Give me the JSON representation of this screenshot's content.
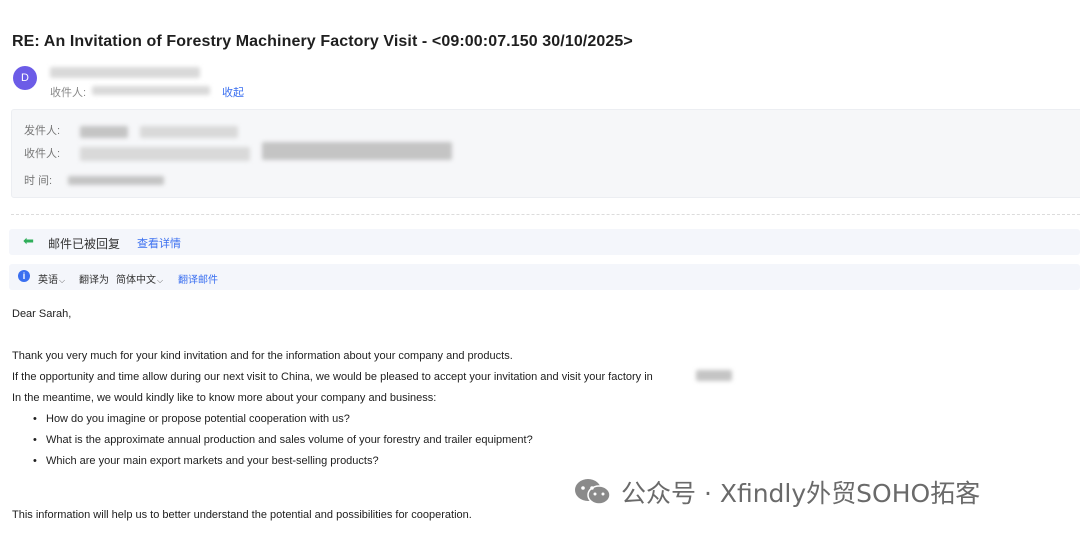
{
  "email": {
    "subject": "RE: An Invitation of Forestry Machinery Factory Visit - <09:00:07.150 30/10/2025>",
    "avatar_letter": "D",
    "recipient_label": "收件人:",
    "collapse_label": "收起"
  },
  "meta": {
    "from_label": "发件人:",
    "to_label": "收件人:",
    "time_label": "时  间:"
  },
  "status": {
    "replied_text": "邮件已被回复",
    "view_details": "查看详情"
  },
  "translate": {
    "source_lang": "英语",
    "translate_to_label": "翻译为",
    "target_lang": "简体中文",
    "translate_mail": "翻译邮件"
  },
  "body": {
    "greeting": "Dear Sarah,",
    "line1": "Thank you very much for your kind invitation and for the information about your company and products.",
    "line2": "If the opportunity and time allow during our next visit to China, we would be pleased to accept your invitation and visit your factory in",
    "line3": "In the meantime, we would kindly like to know more about your company and business:",
    "bullets": [
      "How do you imagine or propose potential cooperation with us?",
      "What is the approximate annual production and sales volume of your forestry and trailer equipment?",
      "Which are your main export markets and your best-selling products?"
    ],
    "closing_line": "This information will help us to better understand the potential and possibilities for cooperation."
  },
  "watermark": {
    "text": "公众号 · Xfindly外贸SOHO拓客"
  },
  "colors": {
    "accent": "#3a6ff0",
    "avatar": "#6c5ce7",
    "reply_icon": "#2fae5a"
  }
}
